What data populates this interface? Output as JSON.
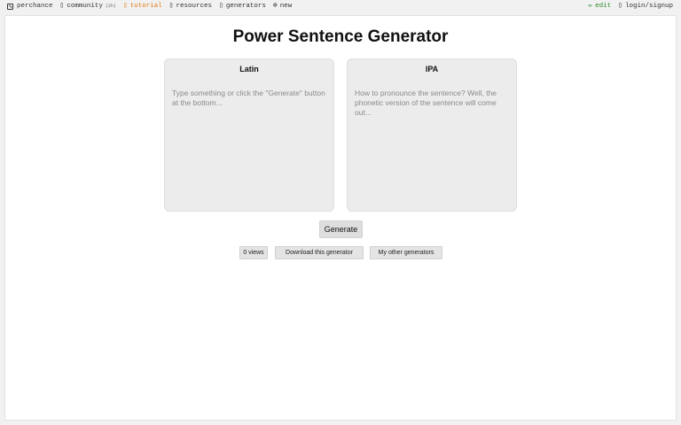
{
  "nav": {
    "left": [
      {
        "label": "perchance",
        "icon": "die-icon"
      },
      {
        "label": "community",
        "badge": "(2h)",
        "icon": "users-icon"
      },
      {
        "label": "tutorial",
        "icon": "book-icon"
      },
      {
        "label": "resources",
        "icon": "box-icon"
      },
      {
        "label": "generators",
        "icon": "grid-icon"
      },
      {
        "label": "new",
        "icon": "plus-circle-icon"
      }
    ],
    "right": [
      {
        "label": "edit",
        "icon": "pencil-icon"
      },
      {
        "label": "login/signup",
        "icon": "user-icon"
      }
    ]
  },
  "colors": {
    "accent": "#e07b16",
    "edit": "#2b8a2b"
  },
  "main": {
    "title": "Power Sentence Generator",
    "latin": {
      "label": "Latin",
      "placeholder": "Type something or click the \"Generate\" button at the bottom..."
    },
    "ipa": {
      "label": "IPA",
      "placeholder": "How to pronounce the sentence? Well, the phonetic version of the sentence will come out..."
    },
    "generate_label": "Generate",
    "views_label": "0 views",
    "download_label": "Download this generator",
    "other_label": "My other generators"
  }
}
